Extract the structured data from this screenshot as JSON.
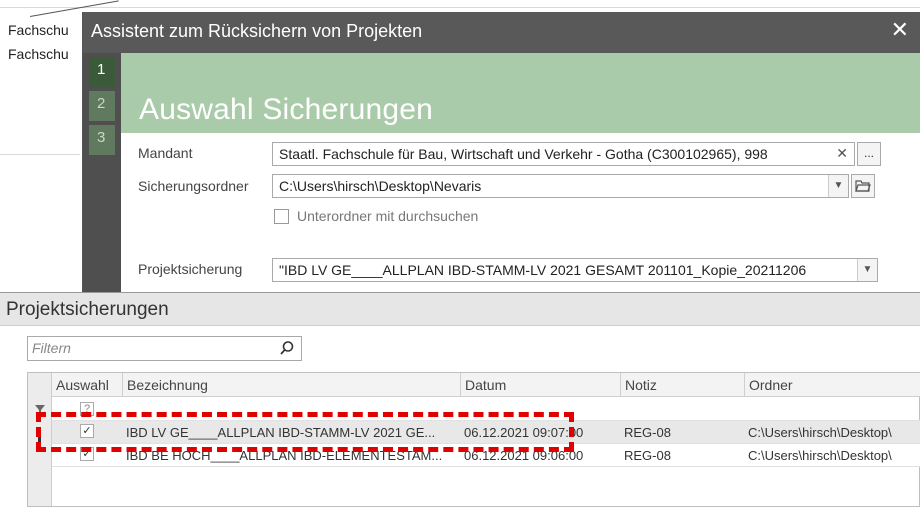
{
  "background": {
    "rows": [
      "Fachschu",
      "Fachschu"
    ]
  },
  "dialog": {
    "title": "Assistent zum Rücksichern von Projekten",
    "close_icon": "close-icon",
    "steps": [
      "1",
      "2",
      "3"
    ],
    "heading": "Auswahl Sicherungen",
    "mandant": {
      "label": "Mandant",
      "value": "Staatl. Fachschule für Bau, Wirtschaft und Verkehr - Gotha (C300102965), 998",
      "more_label": "..."
    },
    "sicherungsordner": {
      "label": "Sicherungsordner",
      "value": "C:\\Users\\hirsch\\Desktop\\Nevaris"
    },
    "unterordner": {
      "label": "Unterordner mit durchsuchen",
      "checked": false
    },
    "projektsicherung": {
      "label": "Projektsicherung",
      "value": "\"IBD LV GE____ALLPLAN IBD-STAMM-LV 2021 GESAMT 201101_Kopie_20211206"
    }
  },
  "panel": {
    "title": "Projektsicherungen",
    "filter_placeholder": "Filtern",
    "columns": [
      "Auswahl",
      "Bezeichnung",
      "Datum",
      "Notiz",
      "Ordner"
    ],
    "filter_row_checkbox": "?",
    "rows": [
      {
        "checked": "✓",
        "bezeichnung": "IBD LV GE____ALLPLAN IBD-STAMM-LV 2021 GE...",
        "datum": "06.12.2021 09:07:00",
        "notiz": "REG-08",
        "ordner": "C:\\Users\\hirsch\\Desktop\\"
      },
      {
        "checked": "✓",
        "bezeichnung": "IBD BE HOCH____ALLPLAN IBD-ELEMENTESTAM...",
        "datum": "06.12.2021 09:06:00",
        "notiz": "REG-08",
        "ordner": "C:\\Users\\hirsch\\Desktop\\"
      }
    ]
  },
  "colors": {
    "titlebar": "#595959",
    "banner": "#aacbaa",
    "highlight": "#e00000"
  }
}
